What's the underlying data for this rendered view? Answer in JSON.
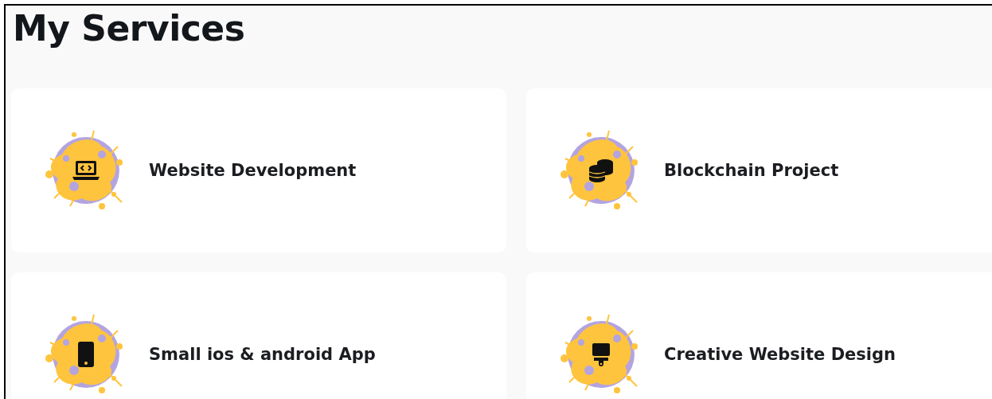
{
  "title": "My Services",
  "services": [
    {
      "kind": "laptop",
      "label": "Website Development"
    },
    {
      "kind": "coins",
      "label": "Blockchain Project"
    },
    {
      "kind": "phone",
      "label": "Small ios & android App"
    },
    {
      "kind": "brush",
      "label": "Creative Website Design"
    }
  ]
}
